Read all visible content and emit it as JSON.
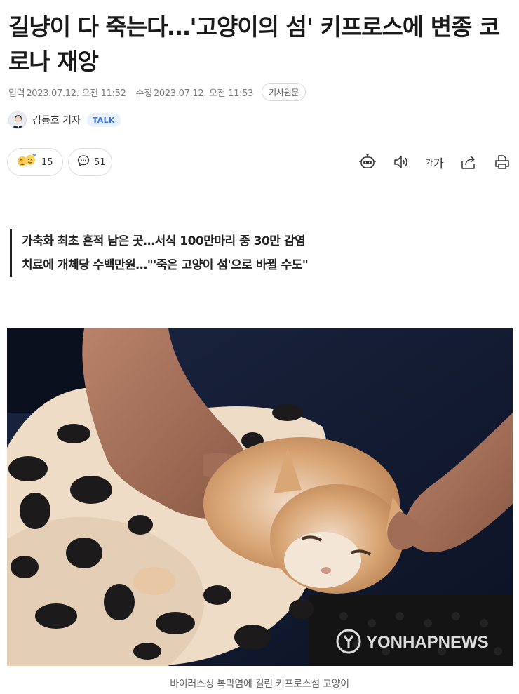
{
  "article": {
    "title": "길냥이 다 죽는다…'고양이의 섬' 키프로스에 변종 코로나 재앙",
    "published_label": "입력",
    "published": "2023.07.12. 오전 11:52",
    "modified_label": "수정",
    "modified": "2023.07.12. 오전 11:53",
    "original_button": "기사원문",
    "reporter": "김동호 기자",
    "talk_button": "TALK",
    "reactions_count": "15",
    "comments_count": "51",
    "font_size_small": "가",
    "font_size_large": "가",
    "summary": [
      "가축화 최초 흔적 남은 곳…서식 100만마리 중 30만 감염",
      "치료에 개체당 수백만원…\"'죽은 고양이 섬'으로 바뀔 수도\""
    ],
    "photo_watermark": "YONHAPNEWS",
    "photo_caption": "바이러스성 복막염에 걸린 키프로스섬 고양이"
  },
  "icons": {
    "reaction": "emoji-reaction-icon",
    "comment": "comment-bubble-icon",
    "summary_bot": "ai-summary-robot-icon",
    "tts": "speaker-icon",
    "font_size": "font-size-icon",
    "share": "share-icon",
    "print": "print-icon"
  },
  "colors": {
    "talk_bg": "#e8f1ff",
    "talk_text": "#3f76d8",
    "meta_text": "#7a7a7a"
  }
}
